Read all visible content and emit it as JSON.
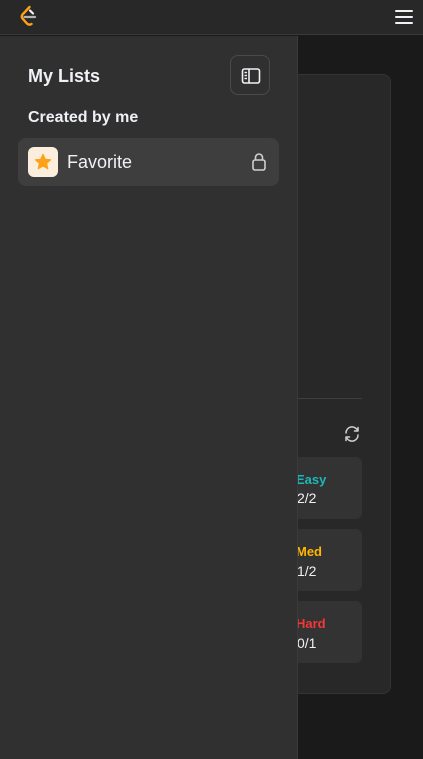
{
  "header": {
    "logo_icon": "leetcode-logo-icon",
    "menu_icon": "hamburger-menu-icon"
  },
  "drawer": {
    "title": "My Lists",
    "collapse_icon": "sidebar-collapse-icon",
    "section_title": "Created by me",
    "lists": [
      {
        "label": "Favorite",
        "icon": "star-icon",
        "status_icon": "lock-icon"
      }
    ]
  },
  "background_panel": {
    "refresh_icon": "refresh-icon",
    "difficulties": [
      {
        "label": "Easy",
        "count": "2/2",
        "color": "#1cb8b8"
      },
      {
        "label": "Med",
        "count": "1/2",
        "color": "#ffb800"
      },
      {
        "label": "Hard",
        "count": "0/1",
        "color": "#f63737"
      }
    ]
  },
  "colors": {
    "drawer_bg": "#303030",
    "page_bg": "#1a1a1a",
    "accent_star": "#ffa116"
  }
}
